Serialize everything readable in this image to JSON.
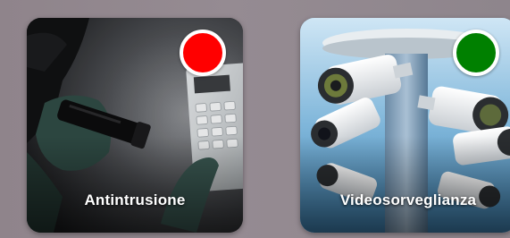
{
  "tiles": [
    {
      "label": "Antintrusione",
      "status_color": "#ff0000",
      "status": "alarm-active",
      "image_icon": "intruder-keypad-image"
    },
    {
      "label": "Videosorveglianza",
      "status_color": "#008000",
      "status": "ok",
      "image_icon": "security-cameras-image"
    }
  ]
}
